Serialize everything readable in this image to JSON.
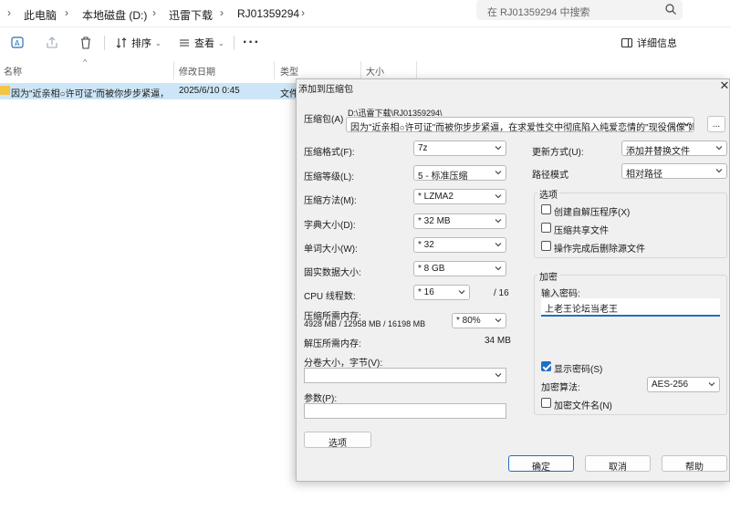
{
  "explorer": {
    "breadcrumb": [
      "此电脑",
      "本地磁盘 (D:)",
      "迅雷下载",
      "RJ01359294"
    ],
    "search_placeholder": "在 RJ01359294 中搜索",
    "toolbar": {
      "sort_label": "排序",
      "view_label": "查看",
      "more_label": "···",
      "details_label": "详细信息"
    },
    "columns": {
      "name": "名称",
      "modified": "修改日期",
      "type": "类型",
      "size": "大小"
    },
    "file": {
      "name": "因为\"近亲相○许可证\"而被你步步紧逼，...",
      "modified": "2025/6/10 0:45",
      "type": "文件"
    }
  },
  "dialog": {
    "title": "添加到压缩包",
    "archive_label": "压缩包(A)",
    "archive_path": "D:\\迅雷下载\\RJ01359294\\",
    "archive_name": "因为\"近亲相○许可证\"而被你步步紧逼，在求爱性交中彻底陷入纯爱恋情的\"现役偶像\"妈妈",
    "browse_label": "...",
    "format_label": "压缩格式(F):",
    "format_value": "7z",
    "level_label": "压缩等级(L):",
    "level_value": "5 - 标准压缩",
    "method_label": "压缩方法(M):",
    "method_value": "* LZMA2",
    "dict_label": "字典大小(D):",
    "dict_value": "* 32 MB",
    "word_label": "单词大小(W):",
    "word_value": "* 32",
    "solid_label": "固实数据大小:",
    "solid_value": "* 8 GB",
    "threads_label": "CPU 线程数:",
    "threads_value": "* 16",
    "threads_max": "/ 16",
    "mem_compress_label": "压缩所需内存:",
    "mem_compress_detail": "4928 MB / 12958 MB / 16198 MB",
    "mem_compress_pct": "* 80%",
    "mem_decompress_label": "解压所需内存:",
    "mem_decompress_value": "34 MB",
    "split_label": "分卷大小，字节(V):",
    "params_label": "参数(P):",
    "options_button": "选项",
    "update_label": "更新方式(U):",
    "update_value": "添加并替换文件",
    "path_mode_label": "路径模式",
    "path_mode_value": "相对路径",
    "options_group": "选项",
    "opt_sfx": "创建自解压程序(X)",
    "opt_shared": "压缩共享文件",
    "opt_delete": "操作完成后删除源文件",
    "encrypt_group": "加密",
    "password_label": "输入密码:",
    "password_value": "上老王论坛当老王",
    "show_password": "显示密码(S)",
    "enc_method_label": "加密算法:",
    "enc_method_value": "AES-256",
    "encrypt_names": "加密文件名(N)",
    "ok": "确定",
    "cancel": "取消",
    "help": "帮助"
  }
}
